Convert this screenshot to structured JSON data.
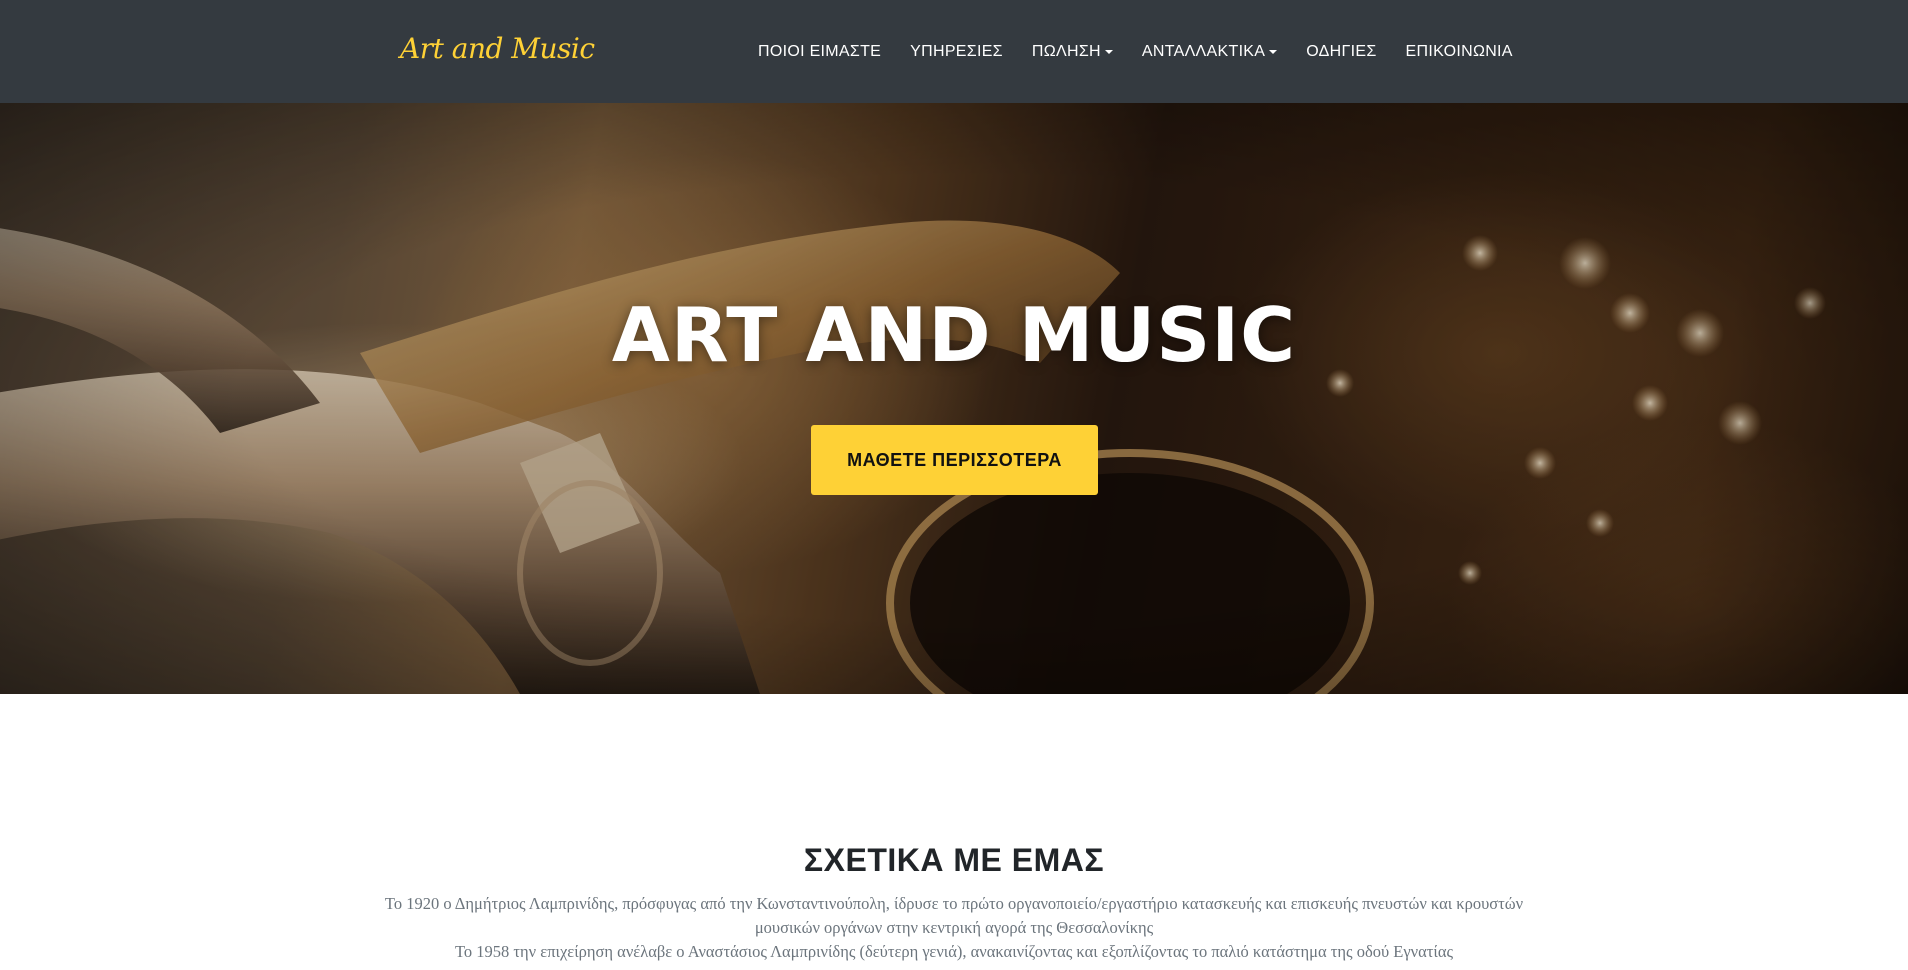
{
  "header": {
    "brand": "Art and Music",
    "nav": [
      {
        "label": "ΠΟΙΟΙ ΕΙΜΑΣΤΕ",
        "dropdown": false
      },
      {
        "label": "ΥΠΗΡΕΣΙΕΣ",
        "dropdown": false
      },
      {
        "label": "ΠΩΛΗΣΗ",
        "dropdown": true
      },
      {
        "label": "ΑΝΤΑΛΛΑΚΤΙΚΑ",
        "dropdown": true
      },
      {
        "label": "ΟΔΗΓΙΕΣ",
        "dropdown": false
      },
      {
        "label": "ΕΠΙΚΟΙΝΩΝΙΑ",
        "dropdown": false
      }
    ]
  },
  "hero": {
    "title": "ART AND MUSIC",
    "button_label": "ΜΑΘΕΤΕ ΠΕΡΙΣΣΟΤΕΡΑ"
  },
  "about": {
    "title": "ΣΧΕΤΙΚΑ ΜΕ ΕΜΑΣ",
    "paragraphs": [
      "Το 1920 ο Δημήτριος Λαμπρινίδης, πρόσφυγας από την Κωνσταντινούπολη, ίδρυσε το πρώτο οργανοποιείο/εργαστήριο κατασκευής και επισκευής πνευστών και κρουστών μουσικών οργάνων στην κεντρική αγορά της Θεσσαλονίκης",
      "Το 1958 την επιχείρηση ανέλαβε ο Αναστάσιος Λαμπρινίδης (δεύτερη γενιά), ανακαινίζοντας και εξοπλίζοντας το παλιό κατάστημα της οδού Εγνατίας"
    ]
  },
  "colors": {
    "navbar_bg": "#343a40",
    "accent": "#fed136",
    "text_muted": "#6c757d"
  }
}
